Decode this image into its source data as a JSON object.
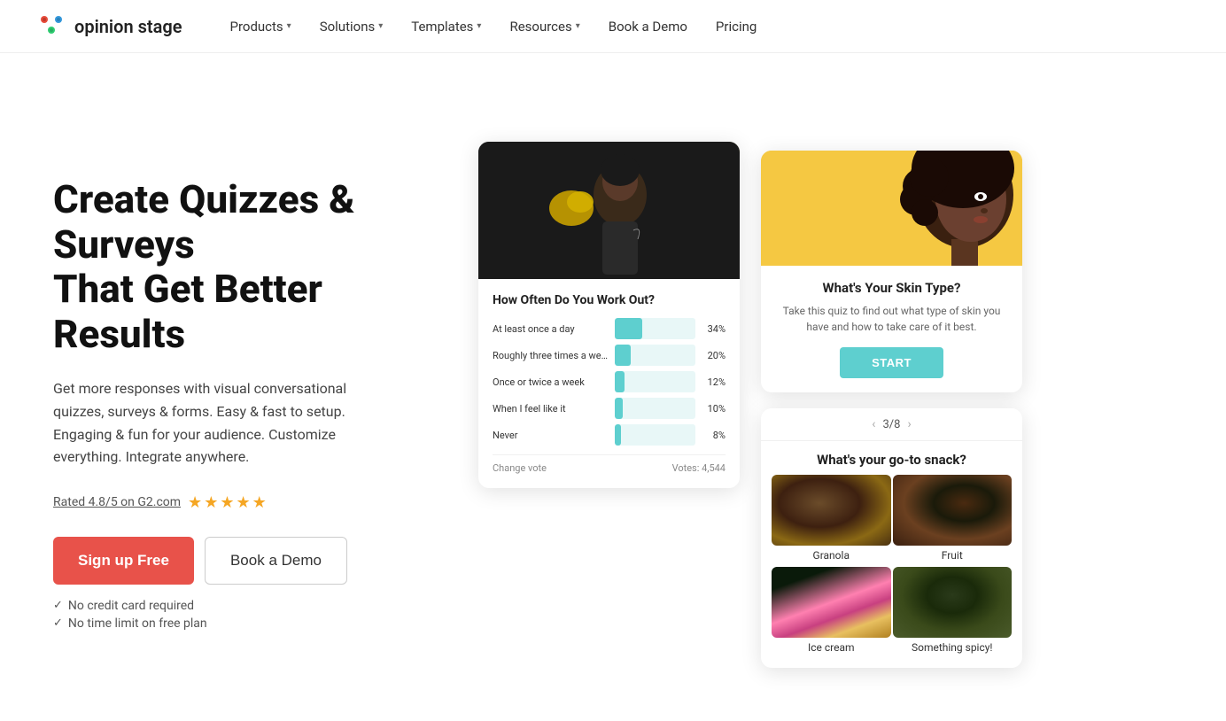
{
  "brand": {
    "name": "opinion stage",
    "logo_colors": [
      "#e74c3c",
      "#3498db",
      "#2ecc71",
      "#f39c12",
      "#9b59b6"
    ]
  },
  "nav": {
    "items": [
      {
        "label": "Products",
        "has_dropdown": true
      },
      {
        "label": "Solutions",
        "has_dropdown": true
      },
      {
        "label": "Templates",
        "has_dropdown": true
      },
      {
        "label": "Resources",
        "has_dropdown": true
      },
      {
        "label": "Book a Demo",
        "has_dropdown": false
      },
      {
        "label": "Pricing",
        "has_dropdown": false
      }
    ]
  },
  "hero": {
    "heading_line1": "Create Quizzes & Surveys",
    "heading_line2": "That Get Better Results",
    "subtext": "Get more responses with visual conversational quizzes, surveys & forms. Easy & fast to setup. Engaging & fun for your audience. Customize everything. Integrate anywhere.",
    "rating_text": "Rated 4.8/5 on G2.com",
    "star_count": 5,
    "cta_primary": "Sign up Free",
    "cta_secondary": "Book a Demo",
    "checklist": [
      "No credit card required",
      "No time limit on free plan"
    ]
  },
  "poll_widget": {
    "title": "How Often Do You Work Out?",
    "bars": [
      {
        "label": "At least once a day",
        "pct": 34,
        "pct_label": "34%"
      },
      {
        "label": "Roughly three times a week",
        "pct": 20,
        "pct_label": "20%"
      },
      {
        "label": "Once or twice a week",
        "pct": 12,
        "pct_label": "12%"
      },
      {
        "label": "When I feel like it",
        "pct": 10,
        "pct_label": "10%"
      },
      {
        "label": "Never",
        "pct": 8,
        "pct_label": "8%"
      }
    ],
    "change_vote": "Change vote",
    "votes_label": "Votes: 4,544"
  },
  "skin_quiz": {
    "title": "What's Your Skin Type?",
    "subtitle": "Take this quiz to find out what type of skin you have and how to take care of it best.",
    "start_label": "START"
  },
  "snack_quiz": {
    "nav_text": "3/8",
    "title": "What's your go-to snack?",
    "options": [
      {
        "label": "Granola"
      },
      {
        "label": "Fruit"
      },
      {
        "label": "Ice cream"
      },
      {
        "label": "Something spicy!"
      }
    ]
  }
}
